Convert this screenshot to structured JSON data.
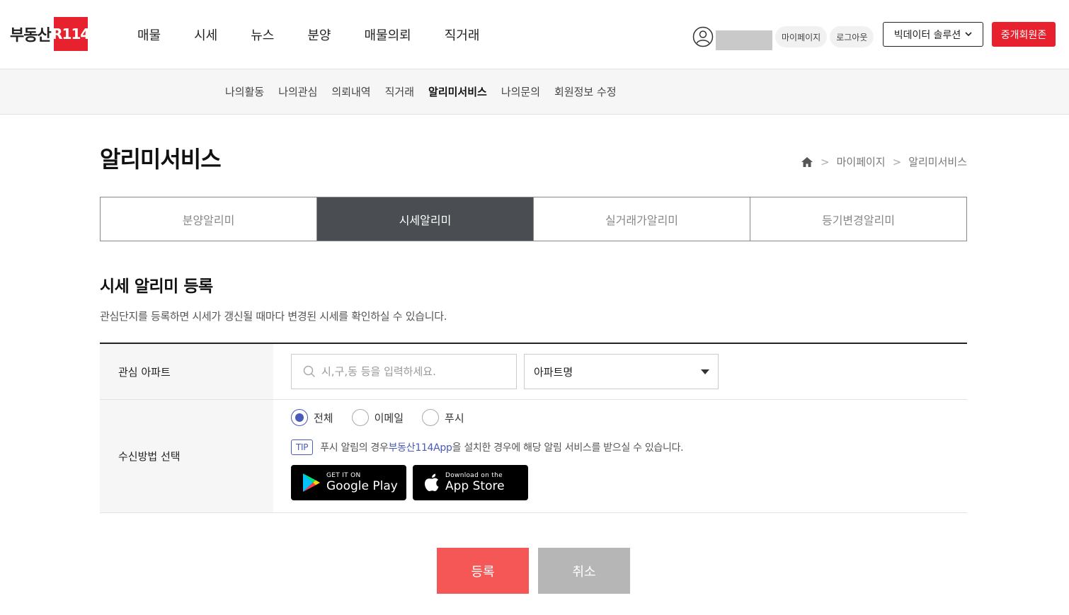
{
  "header": {
    "logo_text": "부동산",
    "logo_box": "R114",
    "gnb": [
      "매물",
      "시세",
      "뉴스",
      "분양",
      "매물의뢰",
      "직거래"
    ],
    "mypage": "마이페이지",
    "logout": "로그아웃",
    "bigdata": "빅데이터 솔루션",
    "broker": "중개회원존"
  },
  "subnav": {
    "items": [
      "나의활동",
      "나의관심",
      "의뢰내역",
      "직거래",
      "알리미서비스",
      "나의문의",
      "회원정보 수정"
    ],
    "active": "알리미서비스"
  },
  "page": {
    "title": "알리미서비스",
    "breadcrumb": [
      "마이페이지",
      "알리미서비스"
    ]
  },
  "tabs": {
    "items": [
      "분양알리미",
      "시세알리미",
      "실거래가알리미",
      "등기변경알리미"
    ],
    "active": "시세알리미"
  },
  "section": {
    "title": "시세 알리미 등록",
    "desc": "관심단지를 등록하면 시세가 갱신될 때마다 변경된 시세를 확인하실 수 있습니다."
  },
  "form": {
    "apt_label": "관심 아파트",
    "search_placeholder": "시,구,동 등을 입력하세요.",
    "select_value": "아파트명",
    "method_label": "수신방법 선택",
    "radios": [
      "전체",
      "이메일",
      "푸시"
    ],
    "radio_selected": "전체",
    "tip_badge": "TIP",
    "tip_pre": "푸시 알림의 경우 ",
    "tip_link": "부동산114App",
    "tip_post": "을 설치한 경우에 해당 알림 서비스를 받으실 수 있습니다.",
    "google_small": "GET IT ON",
    "google_big": "Google Play",
    "apple_small": "Download on the",
    "apple_big": "App Store"
  },
  "buttons": {
    "register": "등록",
    "cancel": "취소"
  }
}
